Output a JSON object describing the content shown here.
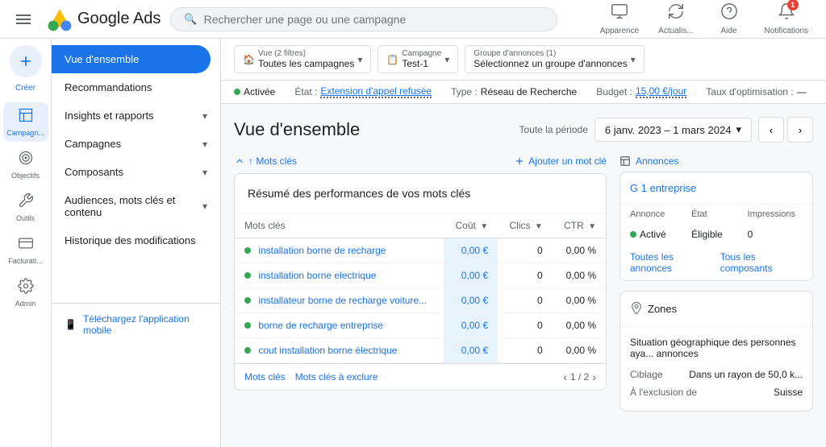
{
  "header": {
    "app_name": "Google Ads",
    "search_placeholder": "Rechercher une page ou une campagne",
    "actions": [
      {
        "id": "apparence",
        "label": "Apparence",
        "icon": "🖥"
      },
      {
        "id": "actualiser",
        "label": "Actualis...",
        "icon": "🔄"
      },
      {
        "id": "aide",
        "label": "Aide",
        "icon": "?"
      },
      {
        "id": "notifications",
        "label": "Notifications",
        "icon": "🔔",
        "badge": "1"
      }
    ]
  },
  "sidebar": {
    "create_label": "Créer",
    "items": [
      {
        "id": "campagnes",
        "label": "Campagn...",
        "icon": "📢",
        "active": true
      },
      {
        "id": "objectifs",
        "label": "Objectifs",
        "icon": "🎯"
      },
      {
        "id": "outils",
        "label": "Outils",
        "icon": "🔧"
      },
      {
        "id": "facturation",
        "label": "Facturati...",
        "icon": "💳"
      },
      {
        "id": "admin",
        "label": "Admin",
        "icon": "⚙"
      }
    ]
  },
  "nav": {
    "items": [
      {
        "id": "vue-ensemble",
        "label": "Vue d'ensemble",
        "active": true,
        "has_chevron": false
      },
      {
        "id": "recommandations",
        "label": "Recommandations",
        "has_chevron": false
      },
      {
        "id": "insights",
        "label": "Insights et rapports",
        "has_chevron": true
      },
      {
        "id": "campagnes",
        "label": "Campagnes",
        "has_chevron": true
      },
      {
        "id": "composants",
        "label": "Composants",
        "has_chevron": true
      },
      {
        "id": "audiences",
        "label": "Audiences, mots clés et contenu",
        "has_chevron": true
      },
      {
        "id": "historique",
        "label": "Historique des modifications",
        "has_chevron": false
      }
    ],
    "footer": "Téléchargez l'application mobile"
  },
  "filters": {
    "vue_label": "Vue (2 filtres)",
    "vue_value": "Toutes les campagnes",
    "campagne_label": "Campagne",
    "campagne_value": "Test-1",
    "groupe_label": "Groupe d'annonces (1)",
    "groupe_value": "Sélectionnez un groupe d'annonces"
  },
  "status_bar": {
    "status": "Activée",
    "etat_label": "État :",
    "etat_value": "Extension d'appel refusée",
    "type_label": "Type :",
    "type_value": "Réseau de Recherche",
    "budget_label": "Budget :",
    "budget_value": "15,00 €/jour",
    "taux_label": "Taux d'optimisation :",
    "taux_value": "—"
  },
  "page": {
    "title": "Vue d'ensemble",
    "date_label": "Toute la période",
    "date_range": "6 janv. 2023 – 1 mars 2024"
  },
  "keywords_table": {
    "title": "Résumé des performances de vos mots clés",
    "columns": [
      "Mots clés",
      "Coût",
      "Clics",
      "CTR"
    ],
    "rows": [
      {
        "keyword": "installation borne de recharge",
        "cout": "0,00 €",
        "clics": "0",
        "ctr": "0,00 %"
      },
      {
        "keyword": "installation borne electrique",
        "cout": "0,00 €",
        "clics": "0",
        "ctr": "0,00 %"
      },
      {
        "keyword": "installateur borne de recharge voiture...",
        "cout": "0,00 €",
        "clics": "0",
        "ctr": "0,00 %"
      },
      {
        "keyword": "borne de recharge entreprise",
        "cout": "0,00 €",
        "clics": "0",
        "ctr": "0,00 %"
      },
      {
        "keyword": "cout installation borne électrique",
        "cout": "0,00 €",
        "clics": "0",
        "ctr": "0,00 %"
      }
    ],
    "footer_tab1": "Mots clés",
    "footer_tab2": "Mots clés à exclure",
    "pagination": "1 / 2",
    "top_links": [
      {
        "label": "↑ Mots clés",
        "icon": "⬆"
      },
      {
        "label": "Ajouter un mot clé",
        "icon": "+"
      }
    ]
  },
  "side_ad": {
    "annonces_label": "Annonces",
    "g1_label": "G 1 entreprise",
    "table_headers": [
      "Annonce",
      "État",
      "Impressions"
    ],
    "ad_status": "Activé",
    "ad_eligible": "Éligible",
    "ad_impressions": "0",
    "link1": "Toutes les annonces",
    "link2": "Tous les composants"
  },
  "zones": {
    "title": "Zones",
    "icon": "📍",
    "description": "Situation géographique des personnes aya... annonces",
    "rows": [
      {
        "label": "Ciblage",
        "value": "Dans un rayon de 50,0 k..."
      },
      {
        "label": "À l'exclusion de",
        "value": "Suisse"
      }
    ]
  },
  "colors": {
    "blue": "#1a73e8",
    "green": "#34a853",
    "red": "#ea4335",
    "border": "#dadce0",
    "bg_light": "#f8f9fa"
  }
}
